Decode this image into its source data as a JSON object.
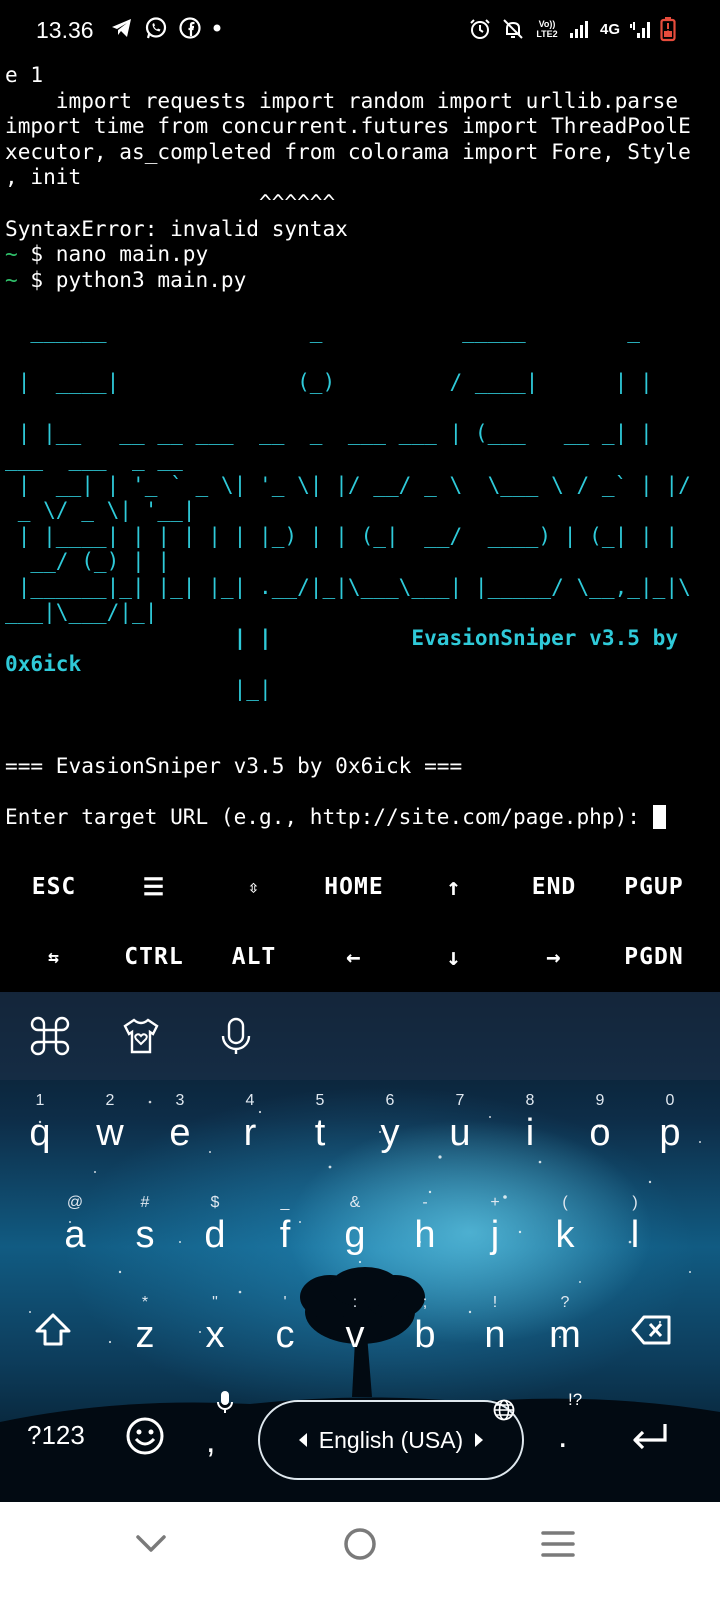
{
  "status_bar": {
    "time": "13.36",
    "left_icons": [
      "telegram-icon",
      "whatsapp-icon",
      "facebook-icon",
      "dot-icon"
    ],
    "right_icons": [
      "alarm-icon",
      "mute-icon",
      "volte-icon",
      "signal-icon",
      "4g-icon",
      "signal2-icon",
      "battery-low-icon"
    ],
    "volte_label": "Vo)) LTE2",
    "network_label": "4G"
  },
  "terminal": {
    "lines": [
      {
        "text": "e 1",
        "style": "plain"
      },
      {
        "text": "    import requests import random import urllib.parse",
        "style": "plain"
      },
      {
        "text": "import time from concurrent.futures import ThreadPoolE",
        "style": "plain"
      },
      {
        "text": "xecutor, as_completed from colorama import Fore, Style",
        "style": "plain"
      },
      {
        "text": ", init",
        "style": "plain"
      },
      {
        "text": "                    ^^^^^^",
        "style": "plain"
      },
      {
        "text": "SyntaxError: invalid syntax",
        "style": "plain"
      },
      {
        "text": "~ $ nano main.py",
        "style": "prompt"
      },
      {
        "text": "~ $ python3 main.py",
        "style": "prompt"
      },
      {
        "text": "",
        "style": "plain"
      },
      {
        "text": "  ______                _           _____        _",
        "style": "ascii"
      },
      {
        "text": "",
        "style": "plain"
      },
      {
        "text": " |  ____|              (_)         / ____|      | |",
        "style": "ascii"
      },
      {
        "text": "",
        "style": "plain"
      },
      {
        "text": " | |__   __ __ ___  __  _  ___ ___ | (___   __ _| |",
        "style": "ascii"
      },
      {
        "text": "___  ___  _ __",
        "style": "ascii"
      },
      {
        "text": " |  __| | '_ ` _ \\| '_ \\| |/ __/ _ \\  \\___ \\ / _` | |/",
        "style": "ascii"
      },
      {
        "text": " _ \\/ _ \\| '__|",
        "style": "ascii"
      },
      {
        "text": " | |____| | | | | | |_) | | (_|  __/  ____) | (_| | |",
        "style": "ascii"
      },
      {
        "text": "  __/ (_) | |",
        "style": "ascii"
      },
      {
        "text": " |______|_| |_| |_| .__/|_|\\___\\___| |_____/ \\__,_|_|\\",
        "style": "ascii"
      },
      {
        "text": "___|\\___/|_|",
        "style": "ascii"
      },
      {
        "text": "                  | |           EvasionSniper v3.5 by",
        "style": "ascii-bold"
      },
      {
        "text": "0x6ick",
        "style": "ascii-bold"
      },
      {
        "text": "                  |_|",
        "style": "ascii"
      },
      {
        "text": "",
        "style": "plain"
      },
      {
        "text": "",
        "style": "plain"
      },
      {
        "text": "=== EvasionSniper v3.5 by 0x6ick ===",
        "style": "plain"
      },
      {
        "text": "",
        "style": "plain"
      },
      {
        "text": "Enter target URL (e.g., http://site.com/page.php): ",
        "style": "input"
      }
    ]
  },
  "extra_keys": {
    "row1": [
      "ESC",
      "☰",
      "⇳",
      "HOME",
      "↑",
      "END",
      "PGUP"
    ],
    "row2": [
      "⇆",
      "CTRL",
      "ALT",
      "←",
      "↓",
      "→",
      "PGDN"
    ]
  },
  "keyboard": {
    "toolbar_icons": [
      "shortcuts-icon",
      "theme-icon",
      "microphone-icon"
    ],
    "row1": [
      {
        "hint": "1",
        "key": "q"
      },
      {
        "hint": "2",
        "key": "w"
      },
      {
        "hint": "3",
        "key": "e"
      },
      {
        "hint": "4",
        "key": "r"
      },
      {
        "hint": "5",
        "key": "t"
      },
      {
        "hint": "6",
        "key": "y"
      },
      {
        "hint": "7",
        "key": "u"
      },
      {
        "hint": "8",
        "key": "i"
      },
      {
        "hint": "9",
        "key": "o"
      },
      {
        "hint": "0",
        "key": "p"
      }
    ],
    "row2": [
      {
        "hint": "@",
        "key": "a"
      },
      {
        "hint": "#",
        "key": "s"
      },
      {
        "hint": "$",
        "key": "d"
      },
      {
        "hint": "_",
        "key": "f"
      },
      {
        "hint": "&",
        "key": "g"
      },
      {
        "hint": "-",
        "key": "h"
      },
      {
        "hint": "+",
        "key": "j"
      },
      {
        "hint": "(",
        "key": "k"
      },
      {
        "hint": ")",
        "key": "l"
      }
    ],
    "row3": [
      {
        "hint": "*",
        "key": "z"
      },
      {
        "hint": "\"",
        "key": "x"
      },
      {
        "hint": "'",
        "key": "c"
      },
      {
        "hint": ":",
        "key": "v"
      },
      {
        "hint": ";",
        "key": "b"
      },
      {
        "hint": "!",
        "key": "n"
      },
      {
        "hint": "?",
        "key": "m"
      }
    ],
    "symbols_label": "?123",
    "comma": ",",
    "period": ".",
    "period_hint": "!?",
    "language": "English (USA)"
  },
  "nav_bar": {
    "icons": [
      "back-chevron-icon",
      "home-circle-icon",
      "recents-menu-icon"
    ]
  }
}
